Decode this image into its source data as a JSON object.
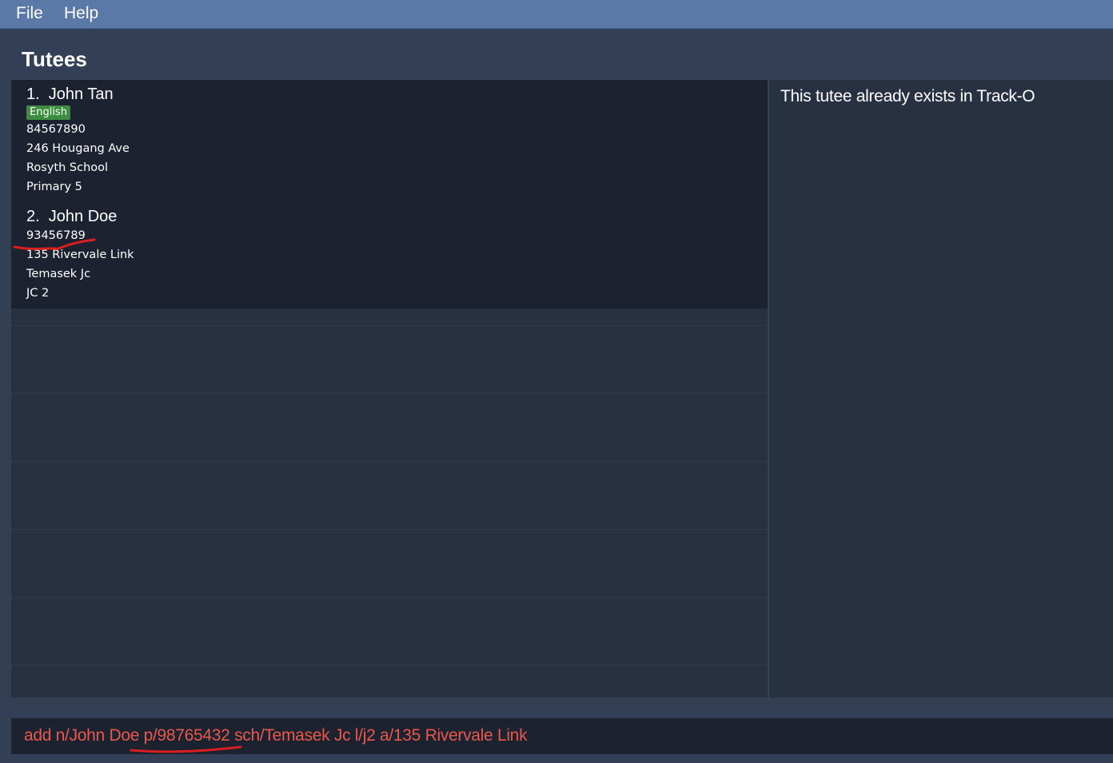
{
  "menu": {
    "file": "File",
    "help": "Help"
  },
  "list_panel": {
    "title": "Tutees",
    "tutees": [
      {
        "index_name": "1.  John Tan",
        "tag": "English",
        "phone": "84567890",
        "address": "246 Hougang Ave",
        "school": "Rosyth School",
        "level": "Primary 5"
      },
      {
        "index_name": "2.  John Doe",
        "phone": "93456789",
        "address": "135 Rivervale Link",
        "school": "Temasek Jc",
        "level": "JC 2"
      }
    ]
  },
  "result_display": {
    "message": "This tutee already exists in Track-O"
  },
  "command_box": {
    "value": "add n/John Doe p/98765432 sch/Temasek Jc l/j2 a/135 Rivervale Link"
  },
  "colors": {
    "menubar": "#5a79a6",
    "background": "#333f54",
    "card": "#1c2230",
    "tag": "#3e8e41",
    "command_text": "#e8584b",
    "annotation": "#d81e1e"
  }
}
